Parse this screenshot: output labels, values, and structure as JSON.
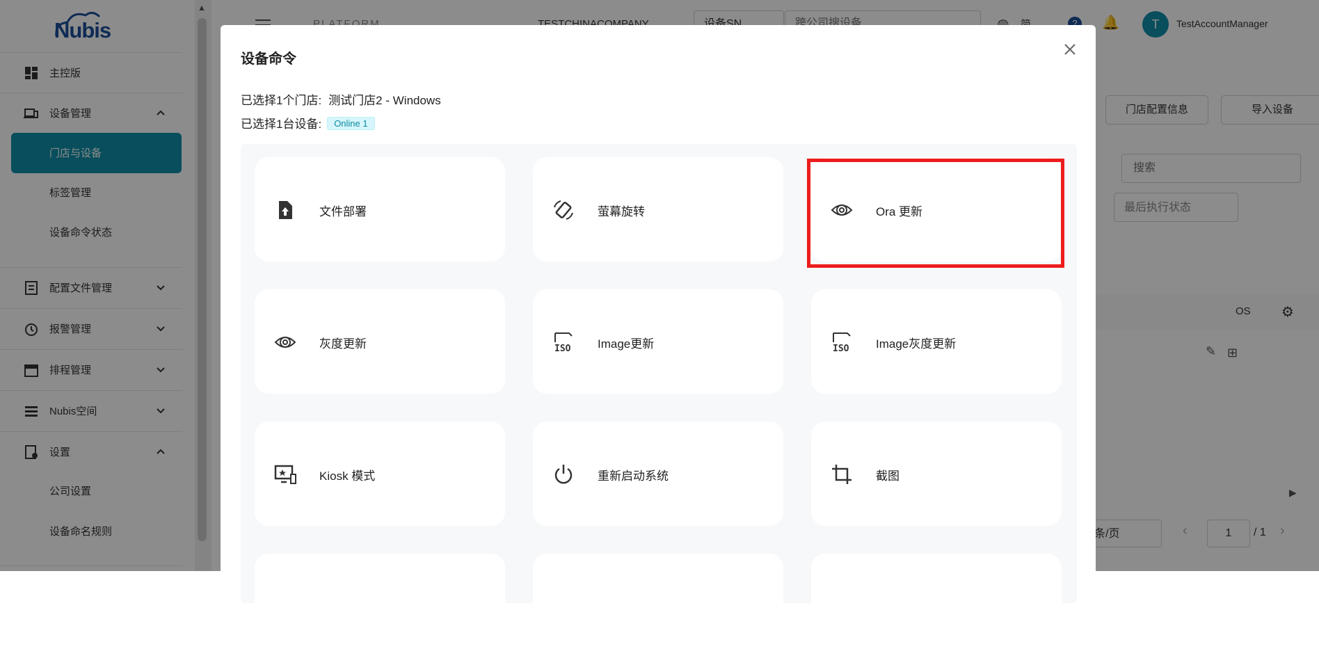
{
  "sidebar": {
    "logo_text": "Nubis",
    "items": [
      {
        "label": "主控版",
        "icon": "dashboard-icon"
      },
      {
        "label": "设备管理",
        "icon": "devices-icon",
        "expanded": true
      },
      {
        "label": "配置文件管理",
        "icon": "config-file-icon"
      },
      {
        "label": "报警管理",
        "icon": "alarm-icon"
      },
      {
        "label": "排程管理",
        "icon": "calendar-icon"
      },
      {
        "label": "Nubis空间",
        "icon": "storage-icon"
      },
      {
        "label": "设置",
        "icon": "settings-icon",
        "expanded": true
      }
    ],
    "device_sub": [
      "门店与设备",
      "标签管理",
      "设备命令状态"
    ],
    "settings_sub": [
      "公司设置",
      "设备命名规则"
    ]
  },
  "topbar": {
    "breadcrumb": "PLATFORM",
    "company": "TESTCHINACOMPANY",
    "search_type": "设备SN",
    "search_placeholder": "跨公司搜设备",
    "language": "简",
    "help_count": "?",
    "avatar_letter": "T",
    "username": "TestAccountManager"
  },
  "background": {
    "btn_store_config": "门店配置信息",
    "btn_import": "导入设备",
    "search_placeholder": "搜索",
    "status_filter": "最后执行状态",
    "col_os": "OS",
    "per_page": "条/页",
    "page_input": "1",
    "page_total": "/ 1"
  },
  "modal": {
    "title": "设备命令",
    "store_label": "已选择1个门店:",
    "store_value": "测试门店2 - Windows",
    "device_label": "已选择1台设备:",
    "online_tag": "Online 1",
    "commands": [
      {
        "label": "文件部署",
        "icon": "file-upload-icon"
      },
      {
        "label": "萤幕旋转",
        "icon": "screen-rotation-icon"
      },
      {
        "label": "Ora 更新",
        "icon": "ora-update-icon"
      },
      {
        "label": "灰度更新",
        "icon": "gray-update-icon"
      },
      {
        "label": "Image更新",
        "icon": "iso-image-icon"
      },
      {
        "label": "Image灰度更新",
        "icon": "iso-image-gray-icon"
      },
      {
        "label": "Kiosk 模式",
        "icon": "kiosk-icon"
      },
      {
        "label": "重新启动系统",
        "icon": "power-icon"
      },
      {
        "label": "截图",
        "icon": "crop-icon"
      }
    ]
  },
  "colors": {
    "accent": "#0f8ea8",
    "highlight": "#ee1c1c",
    "overlay": "rgba(0,0,0,0.45)"
  }
}
